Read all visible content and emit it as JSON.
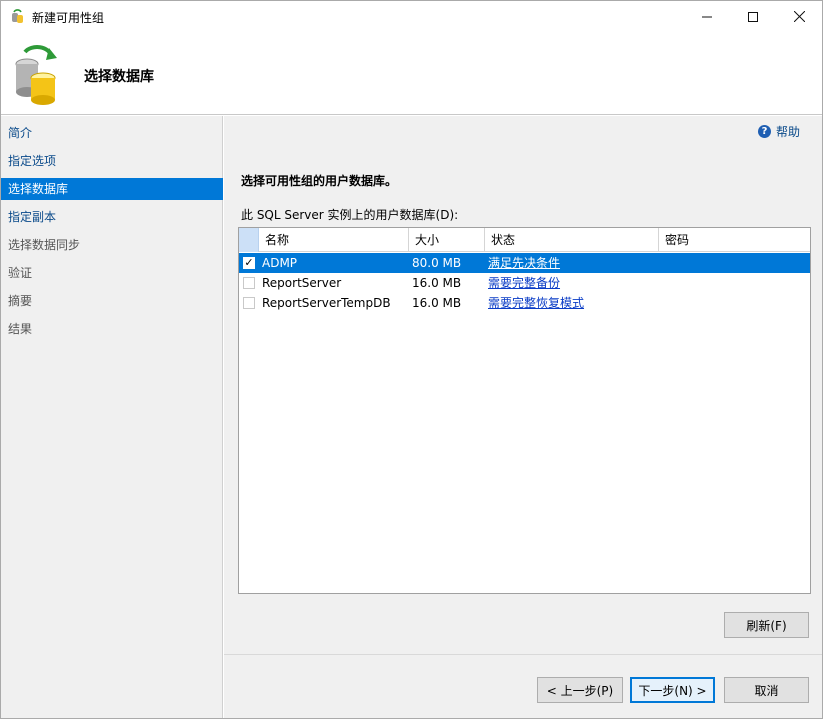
{
  "window": {
    "title": "新建可用性组",
    "controls": {
      "minimize": "—",
      "maximize": "☐",
      "close": "✕"
    }
  },
  "header": {
    "title": "选择数据库"
  },
  "nav": {
    "items": [
      {
        "label": "简介",
        "state": "link"
      },
      {
        "label": "指定选项",
        "state": "link"
      },
      {
        "label": "选择数据库",
        "state": "active"
      },
      {
        "label": "指定副本",
        "state": "link"
      },
      {
        "label": "选择数据同步",
        "state": "disabled"
      },
      {
        "label": "验证",
        "state": "disabled"
      },
      {
        "label": "摘要",
        "state": "disabled"
      },
      {
        "label": "结果",
        "state": "disabled"
      }
    ]
  },
  "content": {
    "help_label": "帮助",
    "section_heading": "选择可用性组的用户数据库。",
    "grid_label": "此 SQL Server 实例上的用户数据库(D):",
    "grid": {
      "columns": [
        "名称",
        "大小",
        "状态",
        "密码"
      ],
      "rows": [
        {
          "checked": true,
          "name": "ADMP",
          "size": "80.0 MB",
          "status": "满足先决条件",
          "password": ""
        },
        {
          "checked": false,
          "name": "ReportServer",
          "size": "16.0 MB",
          "status": "需要完整备份",
          "password": ""
        },
        {
          "checked": false,
          "name": "ReportServerTempDB",
          "size": "16.0 MB",
          "status": "需要完整恢复模式",
          "password": ""
        }
      ]
    },
    "buttons": {
      "refresh": "刷新(F)",
      "back": "< 上一步(P)",
      "next": "下一步(N) >",
      "cancel": "取消"
    }
  },
  "colors": {
    "accent": "#0078d7",
    "link": "#0a4a8a"
  }
}
